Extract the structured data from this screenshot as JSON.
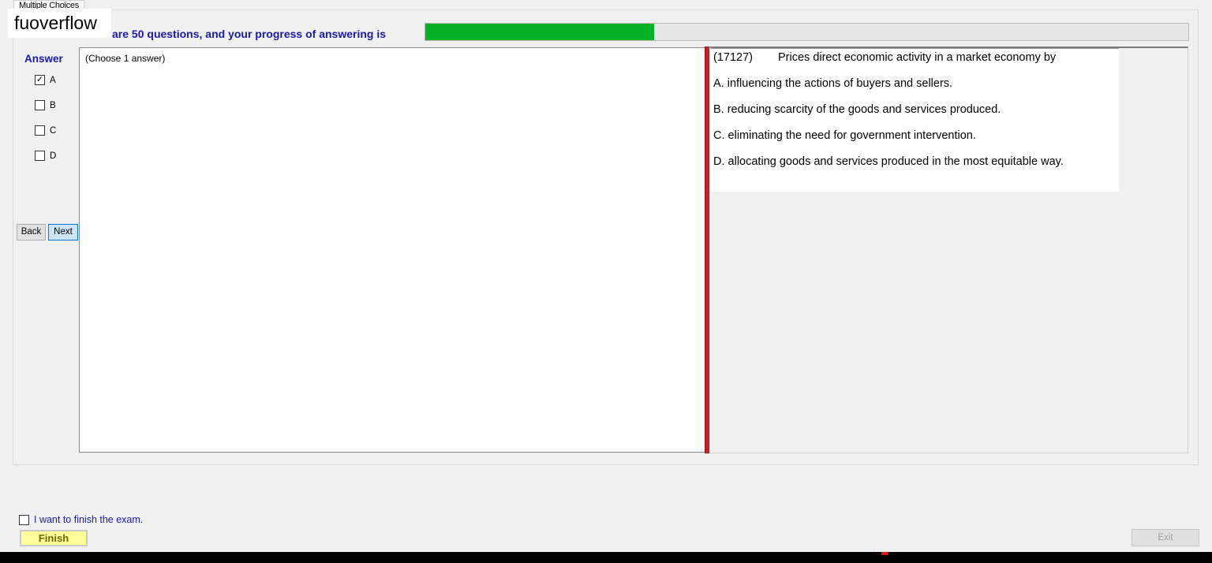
{
  "tab": {
    "label": "Multiple Choices"
  },
  "watermark": {
    "text": "fuoverflow"
  },
  "progress": {
    "label": "There are 50 questions, and your progress of answering is",
    "fraction": 0.3
  },
  "answer_panel": {
    "heading": "Answer",
    "options": [
      {
        "letter": "A",
        "checked": true
      },
      {
        "letter": "B",
        "checked": false
      },
      {
        "letter": "C",
        "checked": false
      },
      {
        "letter": "D",
        "checked": false
      }
    ]
  },
  "nav": {
    "back_label": "Back",
    "next_label": "Next"
  },
  "left_panel": {
    "hint": "(Choose 1 answer)"
  },
  "question": {
    "id": "(17127)",
    "text": "Prices direct economic activity in a market economy by",
    "choices": [
      "A.  influencing the actions of buyers and sellers.",
      "B.  reducing scarcity of the goods and services produced.",
      "C.  eliminating the need for government intervention.",
      "D.  allocating goods and services produced in the most equitable way."
    ]
  },
  "footer": {
    "finish_check_label": "I want to finish the exam.",
    "finish_label": "Finish",
    "exit_label": "Exit"
  },
  "colors": {
    "accent_text": "#1a1aa6",
    "progress_fill": "#06b025",
    "divider": "#e01515",
    "finish_bg": "#ffff99"
  }
}
